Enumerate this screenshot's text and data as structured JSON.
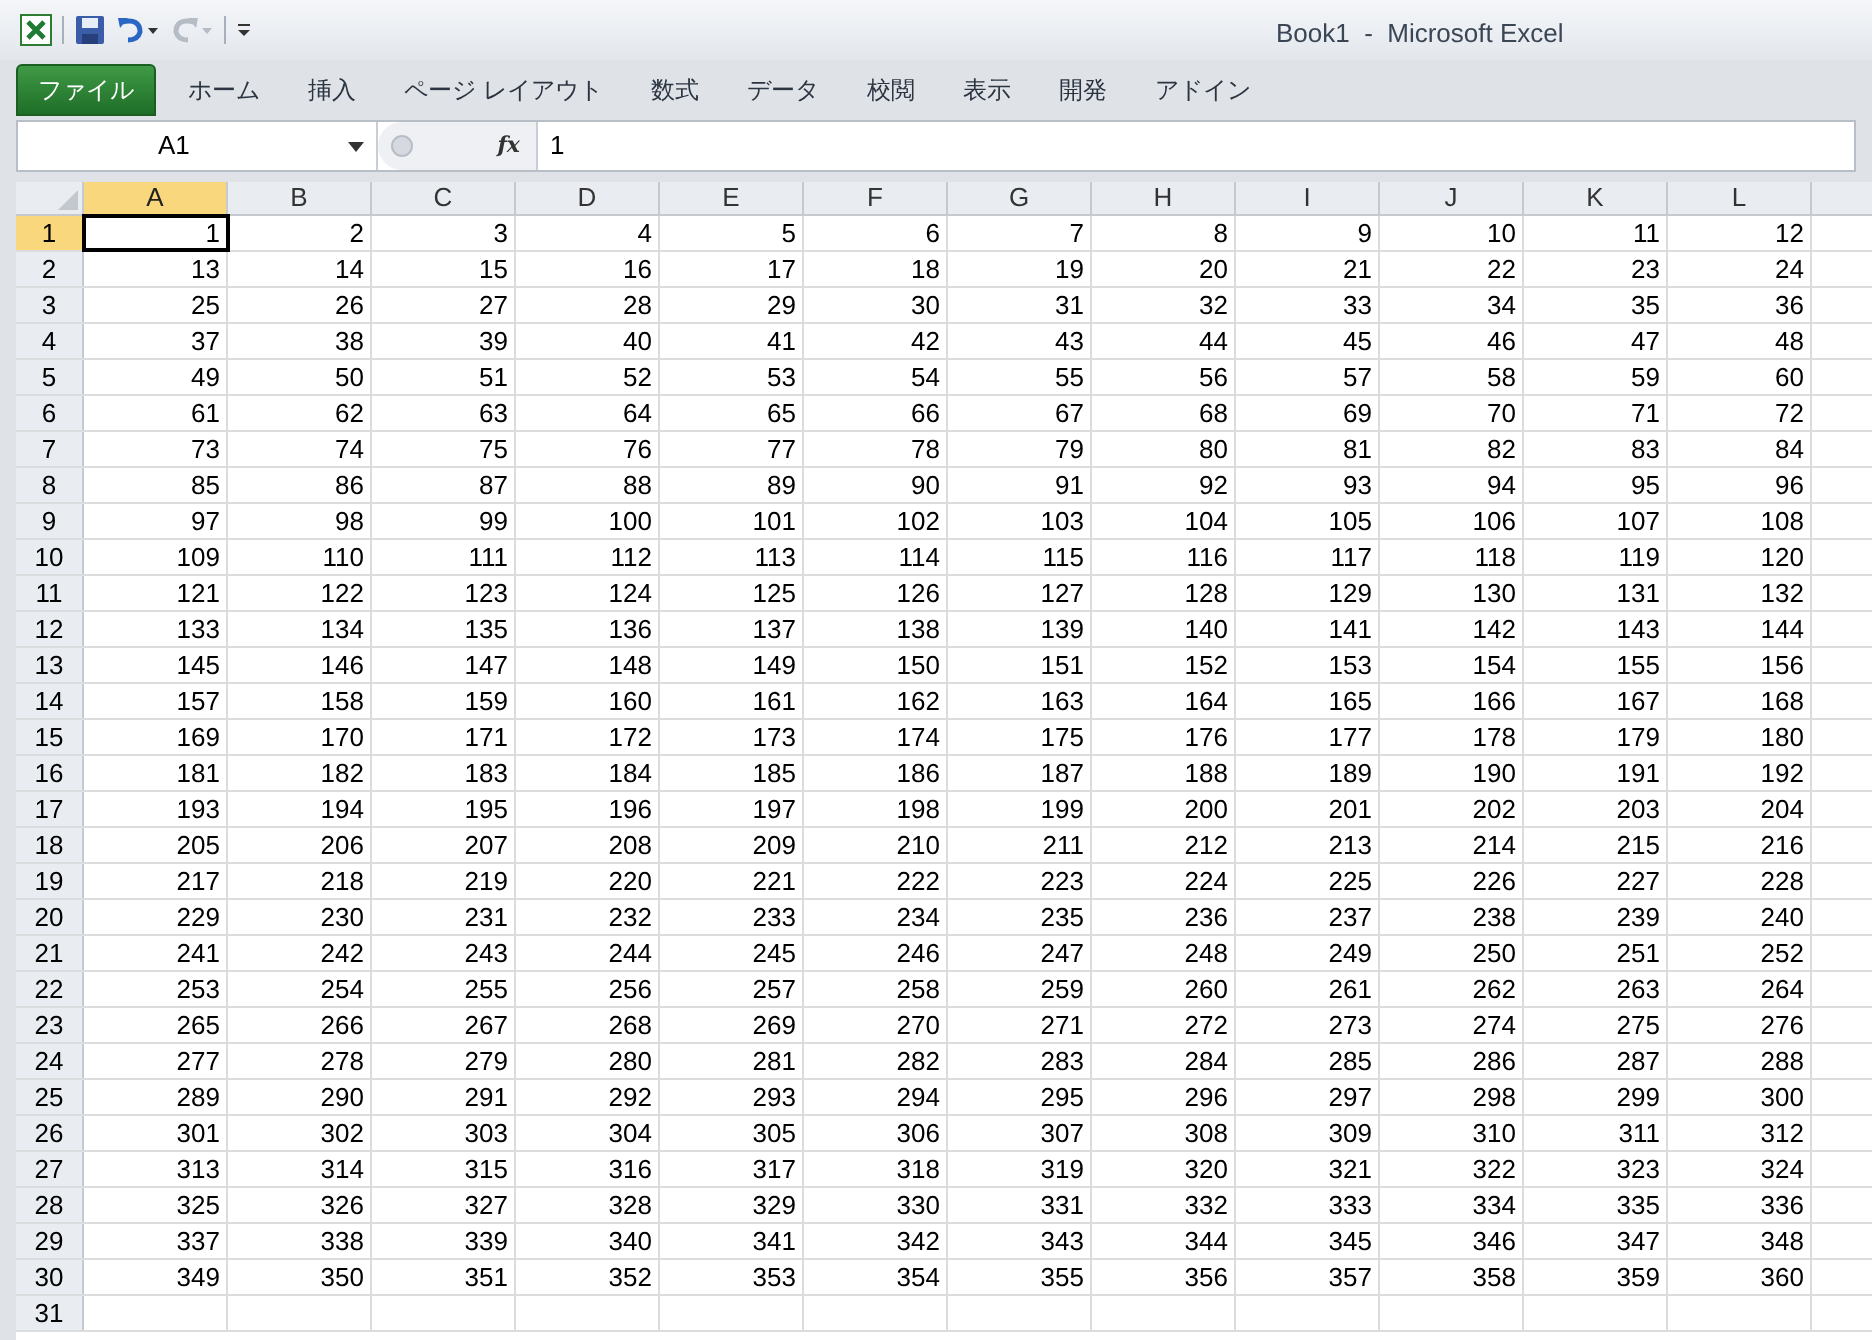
{
  "window": {
    "title": "Book1  -  Microsoft Excel"
  },
  "ribbon_tabs": [
    {
      "label": "ファイル",
      "selected": true
    },
    {
      "label": "ホーム",
      "selected": false
    },
    {
      "label": "挿入",
      "selected": false
    },
    {
      "label": "ページ レイアウト",
      "selected": false
    },
    {
      "label": "数式",
      "selected": false
    },
    {
      "label": "データ",
      "selected": false
    },
    {
      "label": "校閲",
      "selected": false
    },
    {
      "label": "表示",
      "selected": false
    },
    {
      "label": "開発",
      "selected": false
    },
    {
      "label": "アドイン",
      "selected": false
    }
  ],
  "formula_bar": {
    "name_box": "A1",
    "fx": "fx",
    "value": "1"
  },
  "columns": [
    {
      "label": "A",
      "selected": true
    },
    {
      "label": "B",
      "selected": false
    },
    {
      "label": "C",
      "selected": false
    },
    {
      "label": "D",
      "selected": false
    },
    {
      "label": "E",
      "selected": false
    },
    {
      "label": "F",
      "selected": false
    },
    {
      "label": "G",
      "selected": false
    },
    {
      "label": "H",
      "selected": false
    },
    {
      "label": "I",
      "selected": false
    },
    {
      "label": "J",
      "selected": false
    },
    {
      "label": "K",
      "selected": false
    },
    {
      "label": "L",
      "selected": false
    }
  ],
  "rows": [
    {
      "header": "1",
      "selected": true,
      "cells": [
        "1",
        "2",
        "3",
        "4",
        "5",
        "6",
        "7",
        "8",
        "9",
        "10",
        "11",
        "12"
      ]
    },
    {
      "header": "2",
      "selected": false,
      "cells": [
        "13",
        "14",
        "15",
        "16",
        "17",
        "18",
        "19",
        "20",
        "21",
        "22",
        "23",
        "24"
      ]
    },
    {
      "header": "3",
      "selected": false,
      "cells": [
        "25",
        "26",
        "27",
        "28",
        "29",
        "30",
        "31",
        "32",
        "33",
        "34",
        "35",
        "36"
      ]
    },
    {
      "header": "4",
      "selected": false,
      "cells": [
        "37",
        "38",
        "39",
        "40",
        "41",
        "42",
        "43",
        "44",
        "45",
        "46",
        "47",
        "48"
      ]
    },
    {
      "header": "5",
      "selected": false,
      "cells": [
        "49",
        "50",
        "51",
        "52",
        "53",
        "54",
        "55",
        "56",
        "57",
        "58",
        "59",
        "60"
      ]
    },
    {
      "header": "6",
      "selected": false,
      "cells": [
        "61",
        "62",
        "63",
        "64",
        "65",
        "66",
        "67",
        "68",
        "69",
        "70",
        "71",
        "72"
      ]
    },
    {
      "header": "7",
      "selected": false,
      "cells": [
        "73",
        "74",
        "75",
        "76",
        "77",
        "78",
        "79",
        "80",
        "81",
        "82",
        "83",
        "84"
      ]
    },
    {
      "header": "8",
      "selected": false,
      "cells": [
        "85",
        "86",
        "87",
        "88",
        "89",
        "90",
        "91",
        "92",
        "93",
        "94",
        "95",
        "96"
      ]
    },
    {
      "header": "9",
      "selected": false,
      "cells": [
        "97",
        "98",
        "99",
        "100",
        "101",
        "102",
        "103",
        "104",
        "105",
        "106",
        "107",
        "108"
      ]
    },
    {
      "header": "10",
      "selected": false,
      "cells": [
        "109",
        "110",
        "111",
        "112",
        "113",
        "114",
        "115",
        "116",
        "117",
        "118",
        "119",
        "120"
      ]
    },
    {
      "header": "11",
      "selected": false,
      "cells": [
        "121",
        "122",
        "123",
        "124",
        "125",
        "126",
        "127",
        "128",
        "129",
        "130",
        "131",
        "132"
      ]
    },
    {
      "header": "12",
      "selected": false,
      "cells": [
        "133",
        "134",
        "135",
        "136",
        "137",
        "138",
        "139",
        "140",
        "141",
        "142",
        "143",
        "144"
      ]
    },
    {
      "header": "13",
      "selected": false,
      "cells": [
        "145",
        "146",
        "147",
        "148",
        "149",
        "150",
        "151",
        "152",
        "153",
        "154",
        "155",
        "156"
      ]
    },
    {
      "header": "14",
      "selected": false,
      "cells": [
        "157",
        "158",
        "159",
        "160",
        "161",
        "162",
        "163",
        "164",
        "165",
        "166",
        "167",
        "168"
      ]
    },
    {
      "header": "15",
      "selected": false,
      "cells": [
        "169",
        "170",
        "171",
        "172",
        "173",
        "174",
        "175",
        "176",
        "177",
        "178",
        "179",
        "180"
      ]
    },
    {
      "header": "16",
      "selected": false,
      "cells": [
        "181",
        "182",
        "183",
        "184",
        "185",
        "186",
        "187",
        "188",
        "189",
        "190",
        "191",
        "192"
      ]
    },
    {
      "header": "17",
      "selected": false,
      "cells": [
        "193",
        "194",
        "195",
        "196",
        "197",
        "198",
        "199",
        "200",
        "201",
        "202",
        "203",
        "204"
      ]
    },
    {
      "header": "18",
      "selected": false,
      "cells": [
        "205",
        "206",
        "207",
        "208",
        "209",
        "210",
        "211",
        "212",
        "213",
        "214",
        "215",
        "216"
      ]
    },
    {
      "header": "19",
      "selected": false,
      "cells": [
        "217",
        "218",
        "219",
        "220",
        "221",
        "222",
        "223",
        "224",
        "225",
        "226",
        "227",
        "228"
      ]
    },
    {
      "header": "20",
      "selected": false,
      "cells": [
        "229",
        "230",
        "231",
        "232",
        "233",
        "234",
        "235",
        "236",
        "237",
        "238",
        "239",
        "240"
      ]
    },
    {
      "header": "21",
      "selected": false,
      "cells": [
        "241",
        "242",
        "243",
        "244",
        "245",
        "246",
        "247",
        "248",
        "249",
        "250",
        "251",
        "252"
      ]
    },
    {
      "header": "22",
      "selected": false,
      "cells": [
        "253",
        "254",
        "255",
        "256",
        "257",
        "258",
        "259",
        "260",
        "261",
        "262",
        "263",
        "264"
      ]
    },
    {
      "header": "23",
      "selected": false,
      "cells": [
        "265",
        "266",
        "267",
        "268",
        "269",
        "270",
        "271",
        "272",
        "273",
        "274",
        "275",
        "276"
      ]
    },
    {
      "header": "24",
      "selected": false,
      "cells": [
        "277",
        "278",
        "279",
        "280",
        "281",
        "282",
        "283",
        "284",
        "285",
        "286",
        "287",
        "288"
      ]
    },
    {
      "header": "25",
      "selected": false,
      "cells": [
        "289",
        "290",
        "291",
        "292",
        "293",
        "294",
        "295",
        "296",
        "297",
        "298",
        "299",
        "300"
      ]
    },
    {
      "header": "26",
      "selected": false,
      "cells": [
        "301",
        "302",
        "303",
        "304",
        "305",
        "306",
        "307",
        "308",
        "309",
        "310",
        "311",
        "312"
      ]
    },
    {
      "header": "27",
      "selected": false,
      "cells": [
        "313",
        "314",
        "315",
        "316",
        "317",
        "318",
        "319",
        "320",
        "321",
        "322",
        "323",
        "324"
      ]
    },
    {
      "header": "28",
      "selected": false,
      "cells": [
        "325",
        "326",
        "327",
        "328",
        "329",
        "330",
        "331",
        "332",
        "333",
        "334",
        "335",
        "336"
      ]
    },
    {
      "header": "29",
      "selected": false,
      "cells": [
        "337",
        "338",
        "339",
        "340",
        "341",
        "342",
        "343",
        "344",
        "345",
        "346",
        "347",
        "348"
      ]
    },
    {
      "header": "30",
      "selected": false,
      "cells": [
        "349",
        "350",
        "351",
        "352",
        "353",
        "354",
        "355",
        "356",
        "357",
        "358",
        "359",
        "360"
      ]
    },
    {
      "header": "31",
      "selected": false,
      "cells": []
    }
  ]
}
